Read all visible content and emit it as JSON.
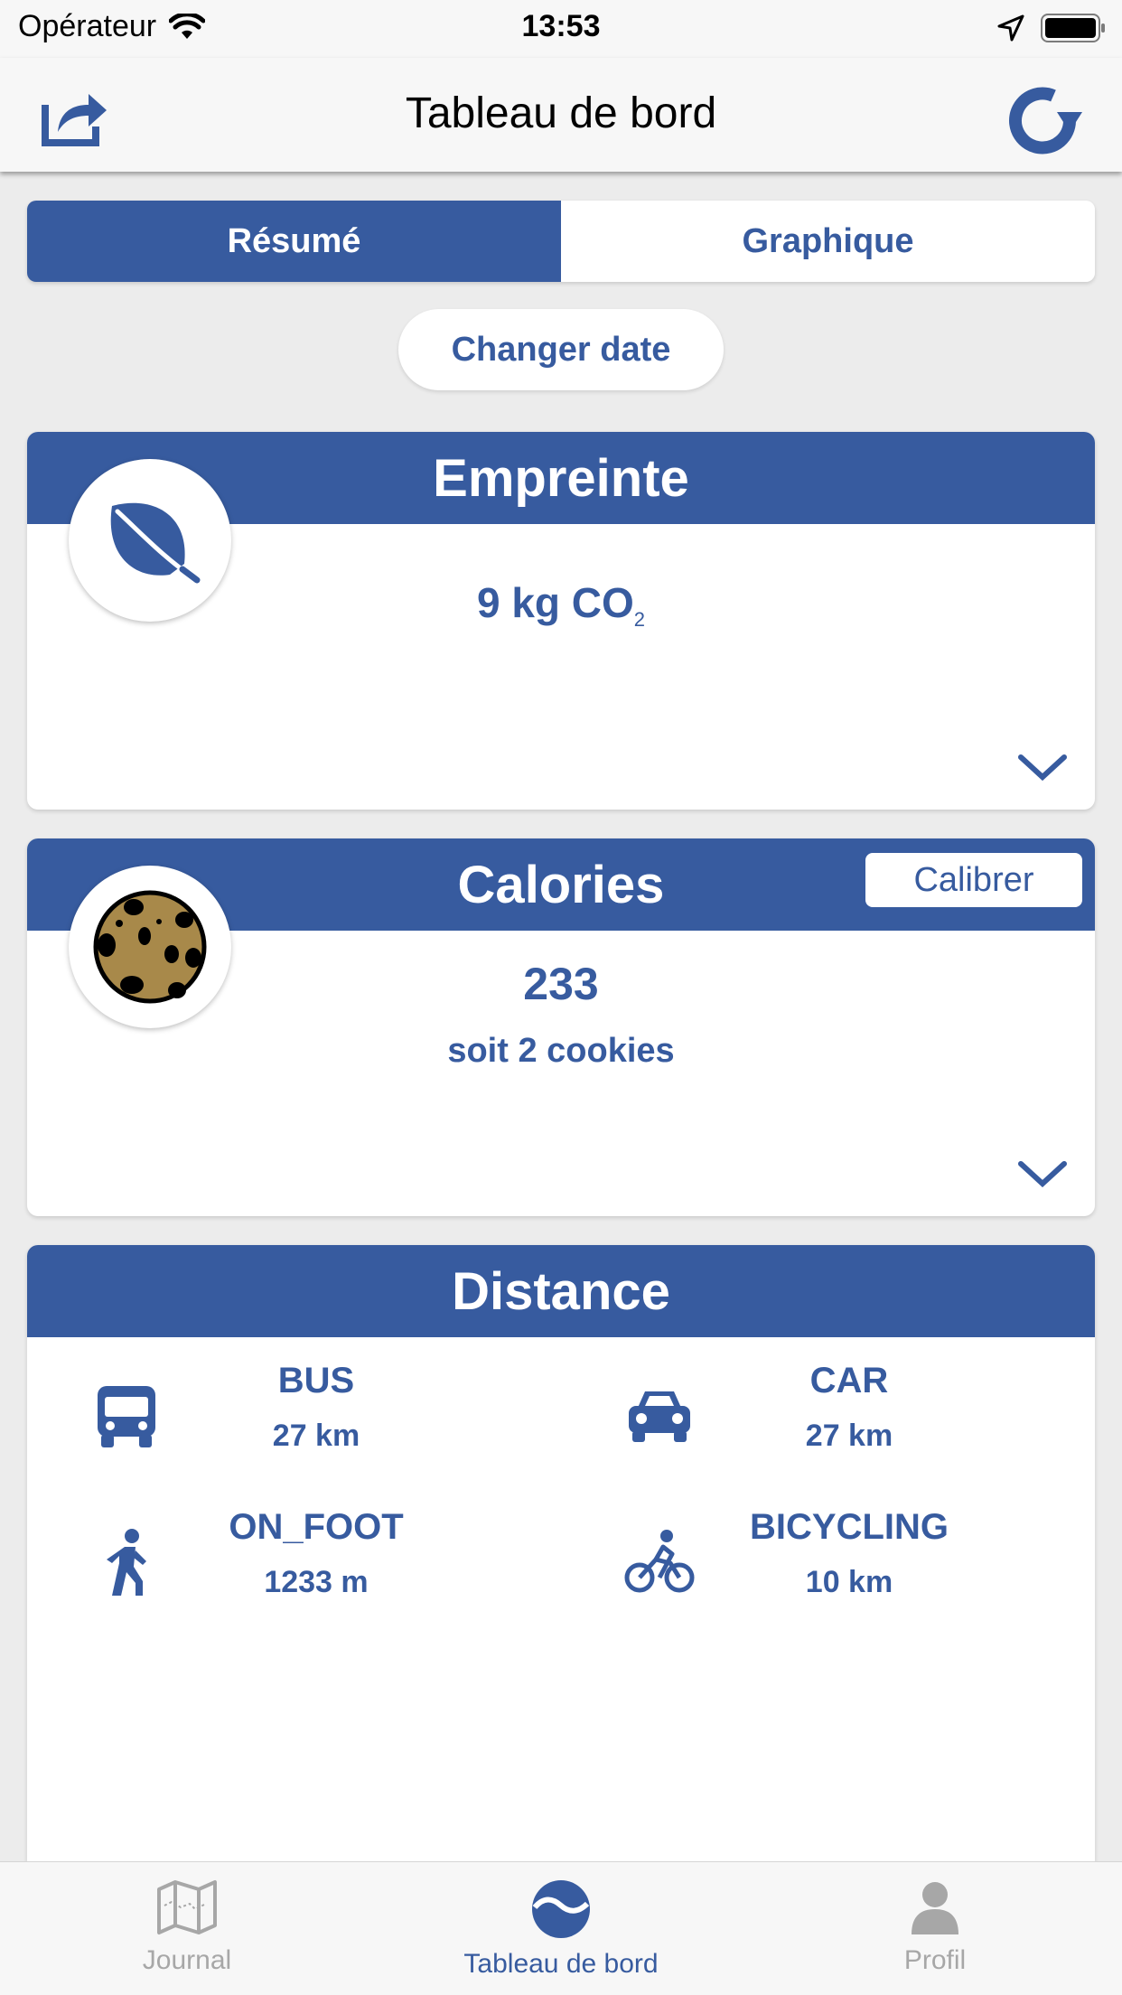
{
  "status_bar": {
    "carrier": "Opérateur",
    "time": "13:53"
  },
  "nav": {
    "title": "Tableau de bord"
  },
  "segment": {
    "active": "Résumé",
    "inactive": "Graphique"
  },
  "date_button": "Changer date",
  "footprint": {
    "title": "Empreinte",
    "value": "9 kg CO",
    "subscript": "2"
  },
  "calories": {
    "title": "Calories",
    "calibrate": "Calibrer",
    "value": "233",
    "equivalent": "soit 2 cookies"
  },
  "distance": {
    "title": "Distance",
    "modes": [
      {
        "name": "BUS",
        "distance": "27 km",
        "icon": "bus-icon"
      },
      {
        "name": "CAR",
        "distance": "27 km",
        "icon": "car-icon"
      },
      {
        "name": "ON_FOOT",
        "distance": "1233 m",
        "icon": "walking-icon"
      },
      {
        "name": "BICYCLING",
        "distance": "10 km",
        "icon": "bicycle-icon"
      }
    ]
  },
  "tabs": [
    {
      "label": "Journal",
      "icon": "map-icon",
      "active": false
    },
    {
      "label": "Tableau de bord",
      "icon": "dashboard-icon",
      "active": true
    },
    {
      "label": "Profil",
      "icon": "person-icon",
      "active": false
    }
  ],
  "colors": {
    "primary": "#375b9f",
    "background": "#ececec",
    "inactive": "#a7a7a7"
  }
}
